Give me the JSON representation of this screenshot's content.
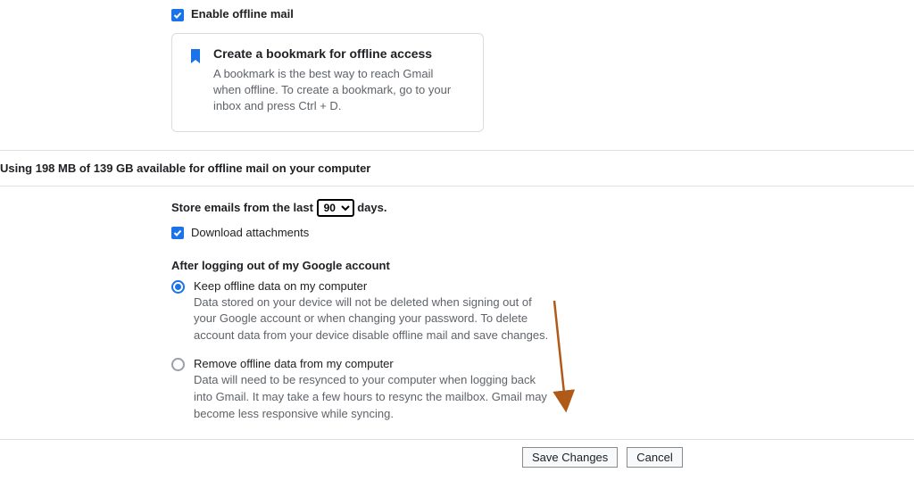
{
  "enable": {
    "label": "Enable offline mail",
    "checked": true
  },
  "card": {
    "title": "Create a bookmark for offline access",
    "body": "A bookmark is the best way to reach Gmail when offline. To create a bookmark, go to your inbox and press Ctrl + D."
  },
  "storage_line": "Using 198 MB of 139 GB available for offline mail on your computer",
  "store": {
    "prefix": "Store emails from the last",
    "suffix": "days.",
    "selected": "90"
  },
  "download_attachments": {
    "label": "Download attachments",
    "checked": true
  },
  "logout_heading": "After logging out of my Google account",
  "options": {
    "keep": {
      "label": "Keep offline data on my computer",
      "desc": "Data stored on your device will not be deleted when signing out of your Google account or when changing your password. To delete account data from your device disable offline mail and save changes."
    },
    "remove": {
      "label": "Remove offline data from my computer",
      "desc": "Data will need to be resynced to your computer when logging back into Gmail. It may take a few hours to resync the mailbox. Gmail may become less responsive while syncing."
    }
  },
  "selected_option": "keep",
  "buttons": {
    "save": "Save Changes",
    "cancel": "Cancel"
  }
}
